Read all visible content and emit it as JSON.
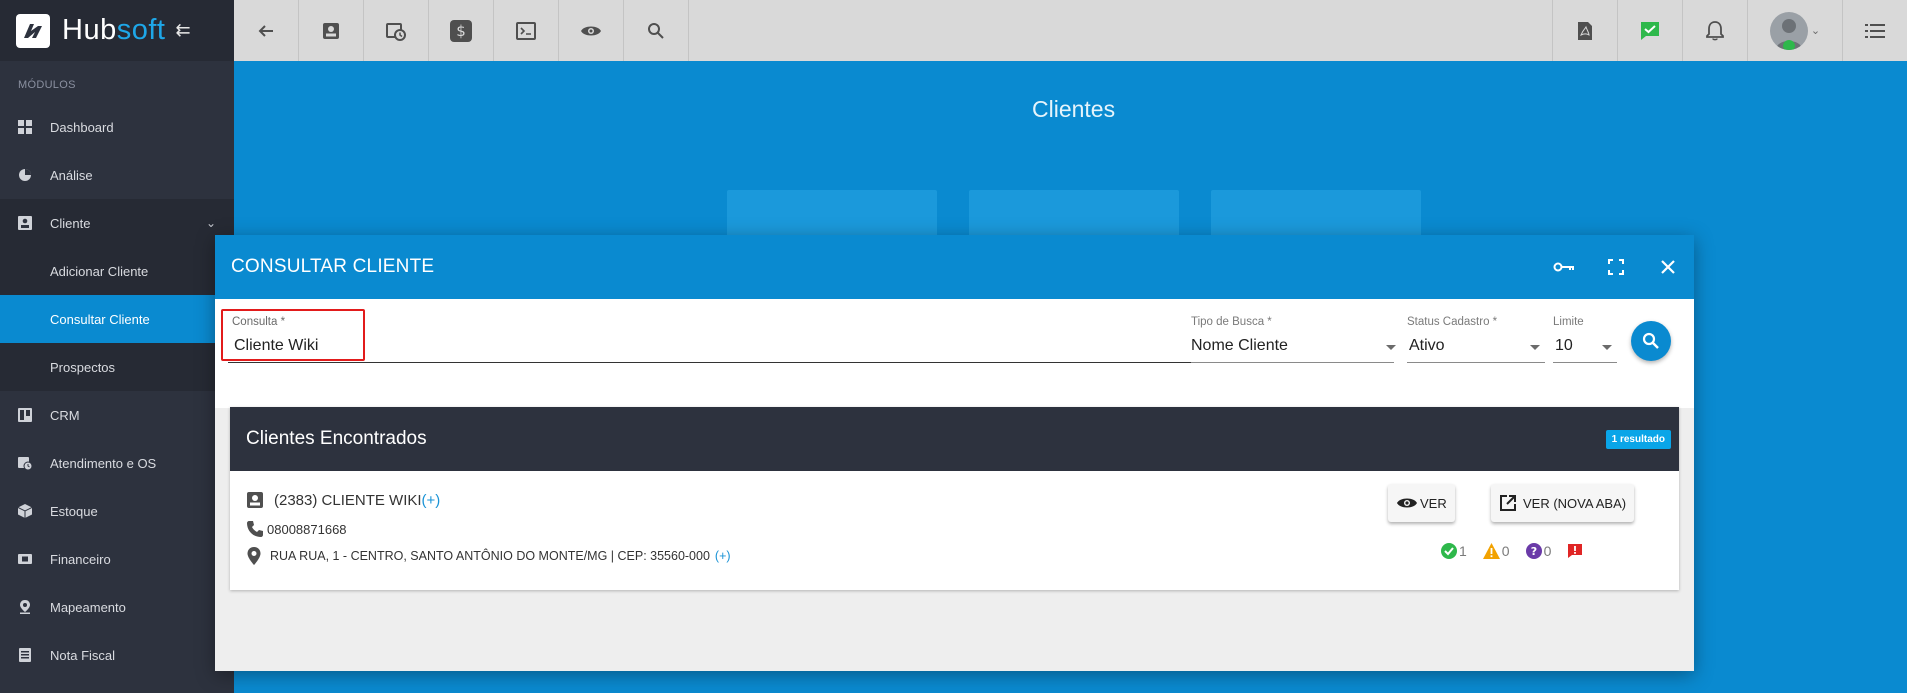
{
  "brand": {
    "name_part1": "Hub",
    "name_part2": "soft"
  },
  "sidebar": {
    "section_label": "MÓDULOS",
    "items": [
      {
        "label": "Dashboard",
        "icon": "grid-icon"
      },
      {
        "label": "Análise",
        "icon": "pie-chart-icon"
      },
      {
        "label": "Cliente",
        "icon": "contact-card-icon",
        "expanded": true,
        "children": [
          {
            "label": "Adicionar Cliente"
          },
          {
            "label": "Consultar Cliente",
            "active": true
          },
          {
            "label": "Prospectos"
          }
        ]
      },
      {
        "label": "CRM",
        "icon": "kanban-icon"
      },
      {
        "label": "Atendimento e OS",
        "icon": "calendar-clock-icon"
      },
      {
        "label": "Estoque",
        "icon": "box-icon"
      },
      {
        "label": "Financeiro",
        "icon": "money-icon"
      },
      {
        "label": "Mapeamento",
        "icon": "map-pin-icon"
      },
      {
        "label": "Nota Fiscal",
        "icon": "document-icon"
      }
    ]
  },
  "page": {
    "title": "Clientes"
  },
  "modal": {
    "title": "CONSULTAR CLIENTE",
    "form": {
      "consulta": {
        "label": "Consulta *",
        "value": "Cliente Wiki"
      },
      "tipo_busca": {
        "label": "Tipo de Busca *",
        "value": "Nome Cliente"
      },
      "status_cadastro": {
        "label": "Status Cadastro *",
        "value": "Ativo"
      },
      "limite": {
        "label": "Limite",
        "value": "10"
      }
    },
    "results": {
      "title": "Clientes Encontrados",
      "badge": "1 resultado",
      "client": {
        "name": "(2383) CLIENTE WIKI",
        "name_plus": "(+)",
        "phone": "08008871668",
        "address": "RUA RUA, 1 - CENTRO, SANTO ANTÔNIO DO MONTE/MG | CEP: 35560-000",
        "address_plus": "(+)",
        "view_label": "VER",
        "view_new_tab_label": "VER (NOVA ABA)",
        "counters": {
          "ok": "1",
          "warning": "0",
          "question": "0"
        }
      }
    }
  },
  "colors": {
    "primary": "#0a8ad0",
    "sidebar": "#2d323e",
    "highlight": "#e21b1b"
  }
}
